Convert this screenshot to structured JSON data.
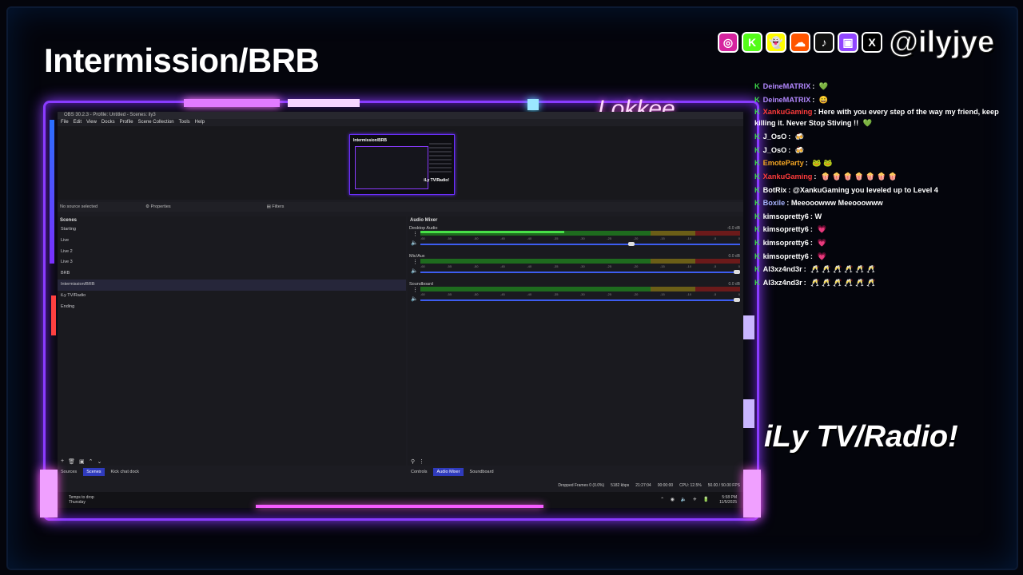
{
  "overlay": {
    "title": "Intermission/BRB",
    "handle": "@ilyjye",
    "tagline": "iLy TV/Radio!",
    "frame_corner_text": "Lokkee",
    "social_icons": [
      {
        "name": "instagram-icon",
        "glyph": "◎",
        "color": "#d6249f"
      },
      {
        "name": "kick-icon",
        "glyph": "K",
        "color": "#53fc18"
      },
      {
        "name": "snapchat-icon",
        "glyph": "👻",
        "color": "#fffc00"
      },
      {
        "name": "soundcloud-icon",
        "glyph": "☁",
        "color": "#ff5500"
      },
      {
        "name": "tiktok-icon",
        "glyph": "♪",
        "color": "#111111"
      },
      {
        "name": "twitch-icon",
        "glyph": "▣",
        "color": "#9146ff"
      },
      {
        "name": "x-icon",
        "glyph": "X",
        "color": "#000000"
      }
    ]
  },
  "obs": {
    "window_title": "OBS 30.2.3 - Profile: Untitled - Scenes: ily3",
    "menu": [
      "File",
      "Edit",
      "View",
      "Docks",
      "Profile",
      "Scene Collection",
      "Tools",
      "Help"
    ],
    "preview_thumb_title": "Intermission/BRB",
    "preview_thumb_caption": "iLy TV/Radio!",
    "no_source": "No source selected",
    "properties": "Properties",
    "filters": "Filters",
    "scenes_header": "Scenes",
    "scenes": [
      "Starting",
      "Live",
      "Live 2",
      "Live 3",
      "BRB",
      "Intermission/BRB",
      "iLy TV/Radio",
      "Ending"
    ],
    "selected_scene": "Intermission/BRB",
    "mixer_header": "Audio Mixer",
    "tracks": [
      {
        "name": "Desktop Audio",
        "db": "-6.0 dB",
        "level": 0.45,
        "fader": 0.67
      },
      {
        "name": "Mic/Aux",
        "db": "0.0 dB",
        "level": 0.0,
        "fader": 1.0
      },
      {
        "name": "Soundboard",
        "db": "0.0 dB",
        "level": 0.0,
        "fader": 1.0
      }
    ],
    "scale": [
      "-60",
      "-55",
      "-50",
      "-45",
      "-40",
      "-35",
      "-30",
      "-25",
      "-20",
      "-15",
      "-10",
      "-5",
      "0"
    ],
    "left_tabs": [
      "Sources",
      "Scenes",
      "Kick chat dock"
    ],
    "left_active": "Scenes",
    "right_tabs": [
      "Controls",
      "Audio Mixer",
      "Soundboard"
    ],
    "right_active": "Audio Mixer",
    "status": {
      "dropped": "Dropped Frames 0 (0.0%)",
      "bitrate": "5182 kbps",
      "live_time": "21:27:04",
      "rec_time": "00:00:00",
      "cpu": "CPU: 12.5%",
      "fps": "50.00 / 50.00 FPS"
    },
    "taskbar": {
      "weather_line1": "Temps to drop",
      "weather_line2": "Thursday",
      "time": "5:58 PM",
      "date": "11/5/2025"
    }
  },
  "chat": [
    {
      "user": "DeineMATRIX",
      "user_color": "#b388ff",
      "text": "",
      "emote": "💚"
    },
    {
      "user": "DeineMATRIX",
      "user_color": "#b388ff",
      "text": "",
      "emote": "😄"
    },
    {
      "user": "XankuGaming",
      "user_color": "#ff3b3b",
      "text": "Here with you every step of the way my friend, keep killing it. Never Stop Stiving !! ",
      "emote": "💚"
    },
    {
      "user": "J_OsO",
      "user_color": "#ffffff",
      "text": "",
      "emote": "🍻"
    },
    {
      "user": "J_OsO",
      "user_color": "#ffffff",
      "text": "",
      "emote": "🍻"
    },
    {
      "user": "EmoteParty",
      "user_color": "#f5a623",
      "text": "",
      "emote": "🐸 🐸"
    },
    {
      "user": "XankuGaming",
      "user_color": "#ff3b3b",
      "text": "",
      "emote": "🍿 🍿 🍿 🍿 🍿 🍿 🍿"
    },
    {
      "user": "BotRix",
      "user_color": "#ffffff",
      "text": "@XankuGaming you leveled up to Level 4",
      "emote": ""
    },
    {
      "user": "Boxile",
      "user_color": "#a8b4ff",
      "text": "Meeooowww Meeooowww",
      "emote": ""
    },
    {
      "user": "kimsopretty6",
      "user_color": "#ffffff",
      "text": "W",
      "emote": ""
    },
    {
      "user": "kimsopretty6",
      "user_color": "#ffffff",
      "text": "",
      "emote": "💗"
    },
    {
      "user": "kimsopretty6",
      "user_color": "#ffffff",
      "text": "",
      "emote": "💗"
    },
    {
      "user": "kimsopretty6",
      "user_color": "#ffffff",
      "text": "",
      "emote": "💗"
    },
    {
      "user": "Al3xz4nd3r",
      "user_color": "#ffffff",
      "text": "",
      "emote": "🥂 🥂 🥂 🥂 🥂 🥂"
    },
    {
      "user": "Al3xz4nd3r",
      "user_color": "#ffffff",
      "text": "",
      "emote": "🥂 🥂 🥂 🥂 🥂 🥂"
    }
  ]
}
